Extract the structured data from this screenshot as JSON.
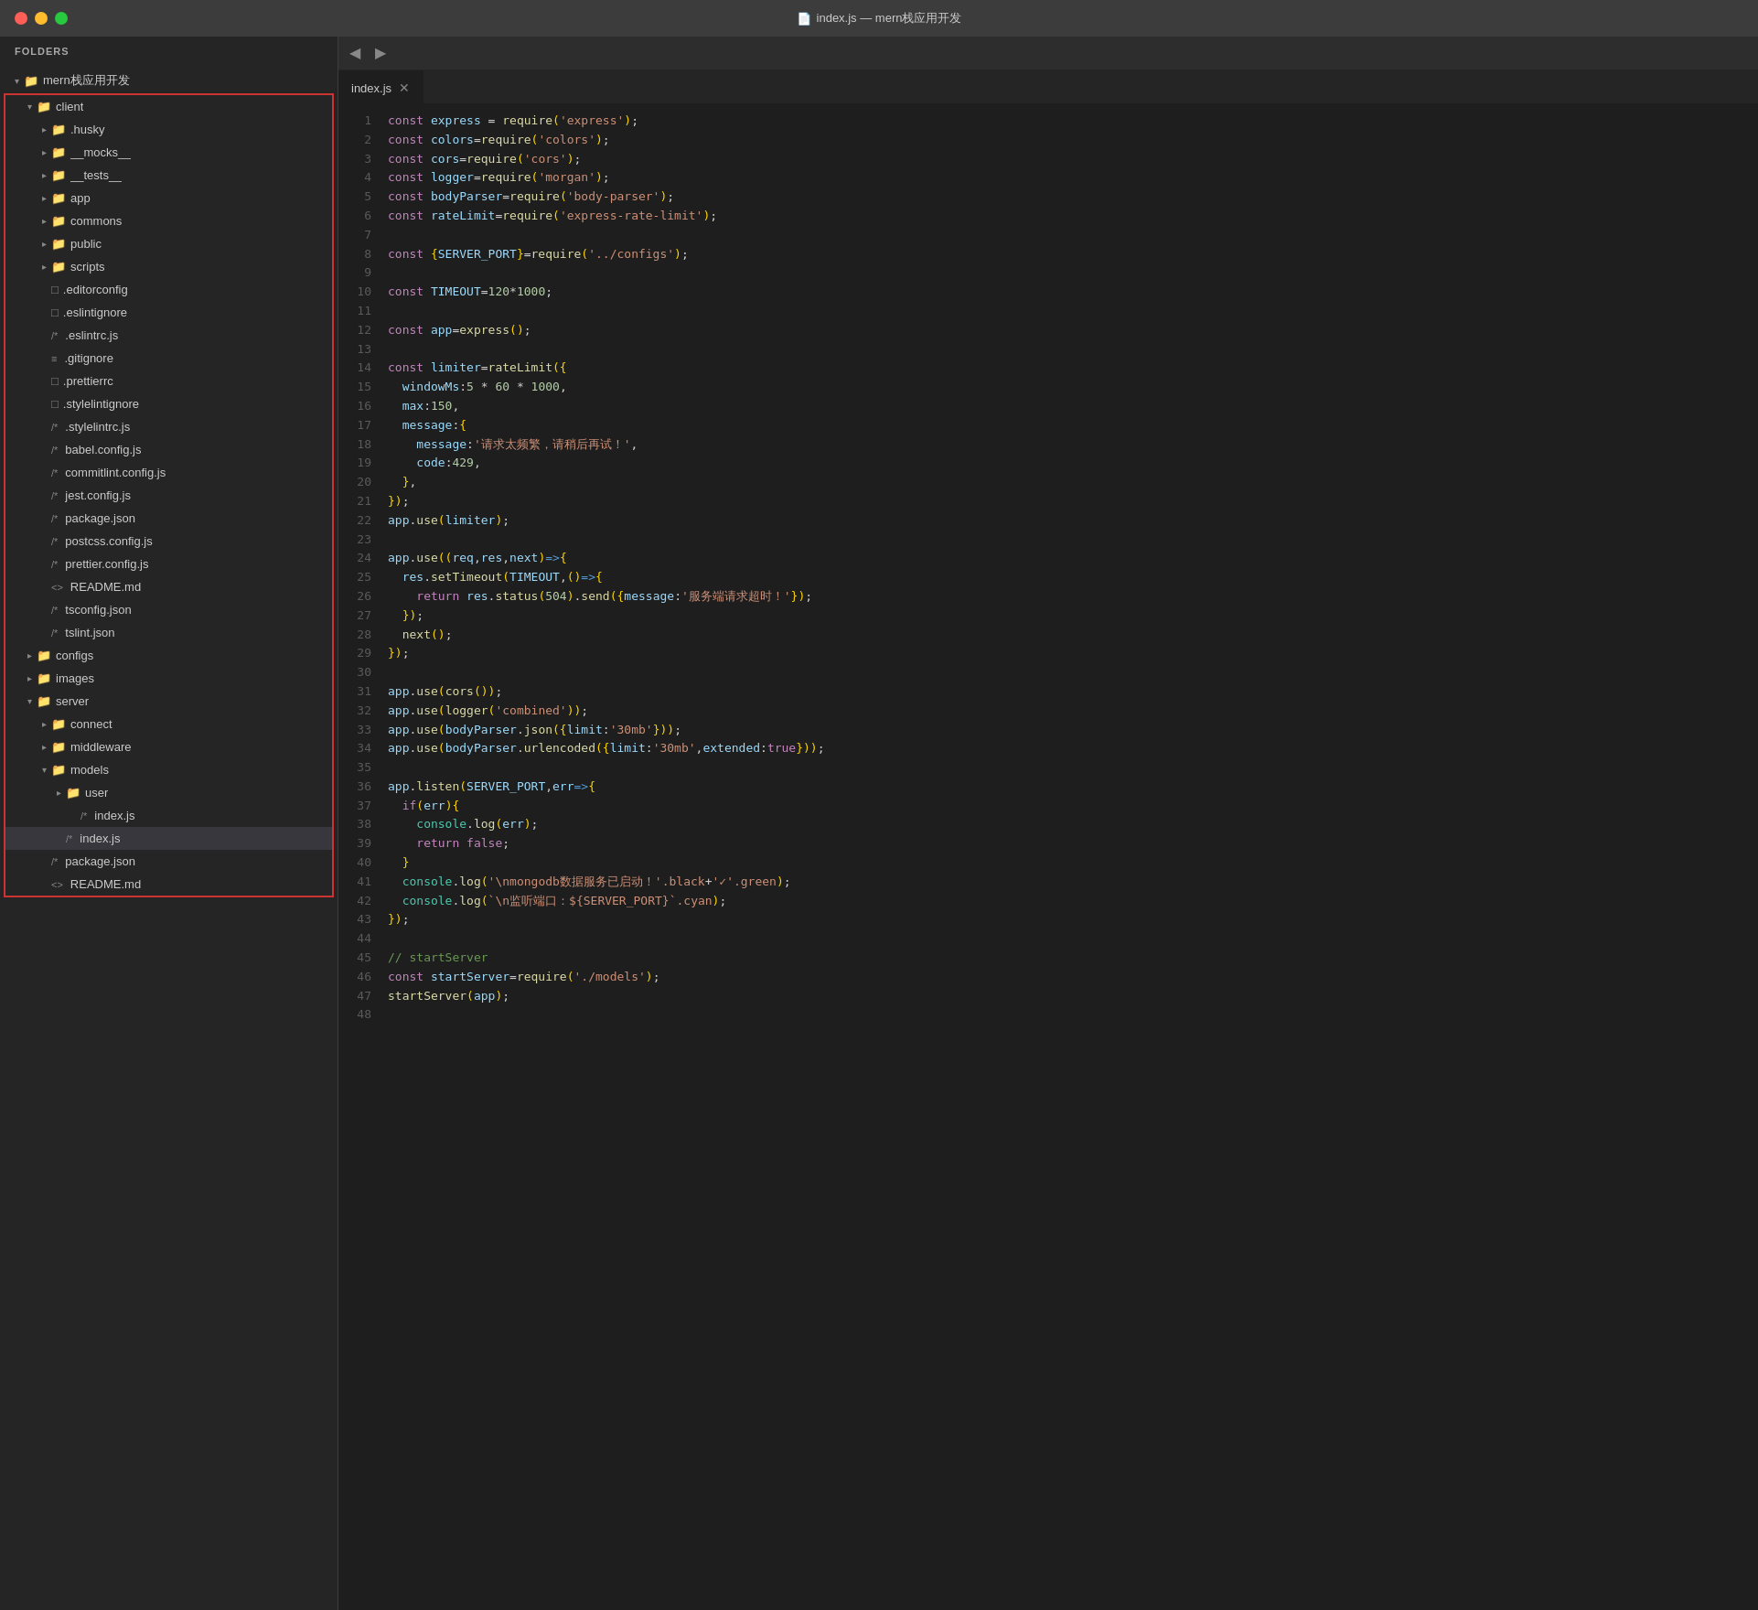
{
  "titleBar": {
    "title": "index.js — mern栈应用开发",
    "icon": "📄"
  },
  "sidebar": {
    "header": "FOLDERS",
    "rootFolder": "mern栈应用开发",
    "items": [
      {
        "id": "client",
        "label": "client",
        "type": "folder",
        "expanded": true,
        "depth": 1,
        "hasChevron": true
      },
      {
        "id": "husky",
        "label": ".husky",
        "type": "folder",
        "expanded": false,
        "depth": 2,
        "hasChevron": true
      },
      {
        "id": "mocks",
        "label": "__mocks__",
        "type": "folder",
        "expanded": false,
        "depth": 2,
        "hasChevron": true
      },
      {
        "id": "tests",
        "label": "__tests__",
        "type": "folder",
        "expanded": false,
        "depth": 2,
        "hasChevron": true
      },
      {
        "id": "app",
        "label": "app",
        "type": "folder",
        "expanded": false,
        "depth": 2,
        "hasChevron": true
      },
      {
        "id": "commons",
        "label": "commons",
        "type": "folder",
        "expanded": false,
        "depth": 2,
        "hasChevron": true
      },
      {
        "id": "public",
        "label": "public",
        "type": "folder",
        "expanded": false,
        "depth": 2,
        "hasChevron": true
      },
      {
        "id": "scripts",
        "label": "scripts",
        "type": "folder",
        "expanded": false,
        "depth": 2,
        "hasChevron": true
      },
      {
        "id": "editorconfig",
        "label": ".editorconfig",
        "type": "file",
        "prefix": "",
        "depth": 2
      },
      {
        "id": "eslintignore",
        "label": ".eslintignore",
        "type": "file",
        "prefix": "",
        "depth": 2
      },
      {
        "id": "eslintrc",
        "label": ".eslintrc.js",
        "type": "file",
        "prefix": "/*",
        "depth": 2
      },
      {
        "id": "gitignore",
        "label": ".gitignore",
        "type": "file",
        "prefix": "≡",
        "depth": 2
      },
      {
        "id": "prettierrc",
        "label": ".prettierrc",
        "type": "file",
        "prefix": "",
        "depth": 2
      },
      {
        "id": "stylelintignore",
        "label": ".stylelintignore",
        "type": "file",
        "prefix": "",
        "depth": 2
      },
      {
        "id": "stylelintrc",
        "label": ".stylelintrc.js",
        "type": "file",
        "prefix": "/*",
        "depth": 2
      },
      {
        "id": "babelconfig",
        "label": "babel.config.js",
        "type": "file",
        "prefix": "/*",
        "depth": 2
      },
      {
        "id": "commitlint",
        "label": "commitlint.config.js",
        "type": "file",
        "prefix": "/*",
        "depth": 2
      },
      {
        "id": "jestconfig",
        "label": "jest.config.js",
        "type": "file",
        "prefix": "/*",
        "depth": 2
      },
      {
        "id": "packagejson",
        "label": "package.json",
        "type": "file",
        "prefix": "/*",
        "depth": 2
      },
      {
        "id": "postcssconfig",
        "label": "postcss.config.js",
        "type": "file",
        "prefix": "/*",
        "depth": 2
      },
      {
        "id": "prettierconfig",
        "label": "prettier.config.js",
        "type": "file",
        "prefix": "/*",
        "depth": 2
      },
      {
        "id": "readme",
        "label": "README.md",
        "type": "file",
        "prefix": "<>",
        "depth": 2
      },
      {
        "id": "tsconfigjson",
        "label": "tsconfig.json",
        "type": "file",
        "prefix": "/*",
        "depth": 2
      },
      {
        "id": "tslint",
        "label": "tslint.json",
        "type": "file",
        "prefix": "/*",
        "depth": 2
      },
      {
        "id": "configs",
        "label": "configs",
        "type": "folder",
        "expanded": false,
        "depth": 1,
        "hasChevron": true
      },
      {
        "id": "images",
        "label": "images",
        "type": "folder",
        "expanded": false,
        "depth": 1,
        "hasChevron": true
      },
      {
        "id": "server",
        "label": "server",
        "type": "folder",
        "expanded": true,
        "depth": 1,
        "hasChevron": true
      },
      {
        "id": "connect",
        "label": "connect",
        "type": "folder",
        "expanded": false,
        "depth": 2,
        "hasChevron": true
      },
      {
        "id": "middleware",
        "label": "middleware",
        "type": "folder",
        "expanded": false,
        "depth": 2,
        "hasChevron": true
      },
      {
        "id": "models",
        "label": "models",
        "type": "folder",
        "expanded": true,
        "depth": 2,
        "hasChevron": true
      },
      {
        "id": "user",
        "label": "user",
        "type": "folder",
        "expanded": false,
        "depth": 3,
        "hasChevron": true
      },
      {
        "id": "models-index",
        "label": "index.js",
        "type": "file",
        "prefix": "/*",
        "depth": 4
      },
      {
        "id": "server-index",
        "label": "index.js",
        "type": "file",
        "prefix": "/*",
        "depth": 3,
        "selected": true
      },
      {
        "id": "server-package",
        "label": "package.json",
        "type": "file",
        "prefix": "/*",
        "depth": 2
      },
      {
        "id": "server-readme",
        "label": "README.md",
        "type": "file",
        "prefix": "<>",
        "depth": 2
      }
    ]
  },
  "editor": {
    "activeTab": "index.js",
    "tabs": [
      {
        "id": "index-js",
        "label": "index.js",
        "active": true
      }
    ],
    "lines": [
      {
        "n": 1,
        "code": "<kw>const</kw> <var>express</var> <op>=</op> <fn>require</fn><paren>(</paren><str>'express'</str><paren>)</paren>;"
      },
      {
        "n": 2,
        "code": "<kw>const</kw> <var>colors</var><op>=</op><fn>require</fn><paren>(</paren><str>'colors'</str><paren>)</paren>;"
      },
      {
        "n": 3,
        "code": "<kw>const</kw> <var>cors</var><op>=</op><fn>require</fn><paren>(</paren><str>'cors'</str><paren>)</paren>;"
      },
      {
        "n": 4,
        "code": "<kw>const</kw> <var>logger</var><op>=</op><fn>require</fn><paren>(</paren><str>'morgan'</str><paren>)</paren>;"
      },
      {
        "n": 5,
        "code": "<kw>const</kw> <var>bodyParser</var><op>=</op><fn>require</fn><paren>(</paren><str>'body-parser'</str><paren>)</paren>;"
      },
      {
        "n": 6,
        "code": "<kw>const</kw> <var>rateLimit</var><op>=</op><fn>require</fn><paren>(</paren><str>'express-rate-limit'</str><paren>)</paren>;"
      },
      {
        "n": 7,
        "code": ""
      },
      {
        "n": 8,
        "code": "<kw>const</kw> <paren>{</paren><var>SERVER_PORT</var><paren>}</paren><op>=</op><fn>require</fn><paren>(</paren><str>'../configs'</str><paren>)</paren>;"
      },
      {
        "n": 9,
        "code": ""
      },
      {
        "n": 10,
        "code": "<kw>const</kw> <var>TIMEOUT</var><op>=</op><num>120</num><op>*</op><num>1000</num>;"
      },
      {
        "n": 11,
        "code": ""
      },
      {
        "n": 12,
        "code": "<kw>const</kw> <var>app</var><op>=</op><fn>express</fn><paren>()</paren>;"
      },
      {
        "n": 13,
        "code": ""
      },
      {
        "n": 14,
        "code": "<kw>const</kw> <var>limiter</var><op>=</op><fn>rateLimit</fn><paren>({</paren>"
      },
      {
        "n": 15,
        "code": "  <var>windowMs</var>:<num>5</num> <op>*</op> <num>60</num> <op>*</op> <num>1000</num>,"
      },
      {
        "n": 16,
        "code": "  <var>max</var>:<num>150</num>,"
      },
      {
        "n": 17,
        "code": "  <var>message</var>:<paren>{</paren>"
      },
      {
        "n": 18,
        "code": "    <var>message</var>:<str>'请求太频繁，请稍后再试！'</str>,"
      },
      {
        "n": 19,
        "code": "    <var>code</var>:<num>429</num>,"
      },
      {
        "n": 20,
        "code": "  <paren>}</paren>,"
      },
      {
        "n": 21,
        "code": "<paren>})</paren>;"
      },
      {
        "n": 22,
        "code": "<var>app</var>.<method>use</method><paren>(</paren><var>limiter</var><paren>)</paren>;"
      },
      {
        "n": 23,
        "code": ""
      },
      {
        "n": 24,
        "code": "<var>app</var>.<method>use</method><paren>((</paren><var>req</var>,<var>res</var>,<var>next</var><paren>)</paren><arrow>=></arrow><paren>{</paren>"
      },
      {
        "n": 25,
        "code": "  <var>res</var>.<method>setTimeout</method><paren>(</paren><var>TIMEOUT</var>,<paren>()</paren><arrow>=></arrow><paren>{</paren>"
      },
      {
        "n": 26,
        "code": "    <kw>return</kw> <var>res</var>.<method>status</method><paren>(</paren><num>504</num><paren>)</paren>.<method>send</method><paren>({</paren><var>message</var>:<str>'服务端请求超时！'</str><paren>})</paren>;"
      },
      {
        "n": 27,
        "code": "  <paren>})</paren>;"
      },
      {
        "n": 28,
        "code": "  <fn>next</fn><paren>()</paren>;"
      },
      {
        "n": 29,
        "code": "<paren>})</paren>;"
      },
      {
        "n": 30,
        "code": ""
      },
      {
        "n": 31,
        "code": "<var>app</var>.<method>use</method><paren>(</paren><fn>cors</fn><paren>())</paren>;"
      },
      {
        "n": 32,
        "code": "<var>app</var>.<method>use</method><paren>(</paren><fn>logger</fn><paren>(</paren><str>'combined'</str><paren>))</paren>;"
      },
      {
        "n": 33,
        "code": "<var>app</var>.<method>use</method><paren>(</paren><var>bodyParser</var>.<method>json</method><paren>({</paren><var>limit</var>:<str>'30mb'</str><paren>}))</paren>;"
      },
      {
        "n": 34,
        "code": "<var>app</var>.<method>use</method><paren>(</paren><var>bodyParser</var>.<method>urlencoded</method><paren>({</paren><var>limit</var>:<str>'30mb'</str>,<var>extended</var>:<kw>true</kw><paren>}))</paren>;"
      },
      {
        "n": 35,
        "code": ""
      },
      {
        "n": 36,
        "code": "<var>app</var>.<method>listen</method><paren>(</paren><var>SERVER_PORT</var>,<var>err</var><arrow>=></arrow><paren>{</paren>"
      },
      {
        "n": 37,
        "code": "  <kw>if</kw><paren>(</paren><var>err</var><paren>){</paren>"
      },
      {
        "n": 38,
        "code": "    <cn>console</cn>.<method>log</method><paren>(</paren><var>err</var><paren>)</paren>;"
      },
      {
        "n": 39,
        "code": "    <kw>return</kw> <kw>false</kw>;"
      },
      {
        "n": 40,
        "code": "  <paren>}</paren>"
      },
      {
        "n": 41,
        "code": "  <cn>console</cn>.<method>log</method><paren>(</paren><str>'\\nmongodb数据服务已启动！'.black</str><op>+</op><str>'✓'.green</str><paren>)</paren>;"
      },
      {
        "n": 42,
        "code": "  <cn>console</cn>.<method>log</method><paren>(</paren><str>`\\n监听端口：${SERVER_PORT}`.cyan</str><paren>)</paren>;"
      },
      {
        "n": 43,
        "code": "<paren>})</paren>;"
      },
      {
        "n": 44,
        "code": ""
      },
      {
        "n": 45,
        "code": "<cm>// startServer</cm>"
      },
      {
        "n": 46,
        "code": "<kw>const</kw> <var>startServer</var><op>=</op><fn>require</fn><paren>(</paren><str>'./models'</str><paren>)</paren>;"
      },
      {
        "n": 47,
        "code": "<fn>startServer</fn><paren>(</paren><var>app</var><paren>)</paren>;"
      },
      {
        "n": 48,
        "code": ""
      }
    ]
  }
}
